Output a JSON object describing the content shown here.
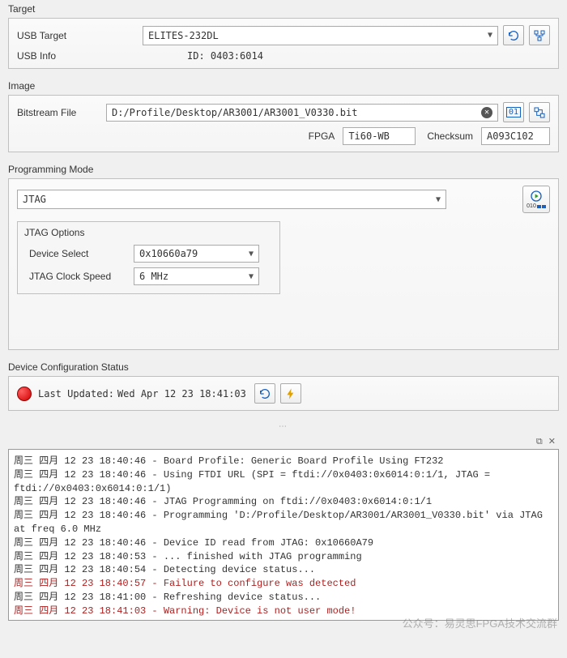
{
  "target": {
    "section_title": "Target",
    "usb_target_label": "USB Target",
    "usb_target_value": "ELITES-232DL",
    "usb_info_label": "USB Info",
    "usb_info_value": "ID: 0403:6014"
  },
  "image": {
    "section_title": "Image",
    "bitstream_label": "Bitstream File",
    "bitstream_value": "D:/Profile/Desktop/AR3001/AR3001_V0330.bit",
    "fpga_label": "FPGA",
    "fpga_value": "Ti60-WB",
    "checksum_label": "Checksum",
    "checksum_value": "A093C102"
  },
  "prog": {
    "section_title": "Programming Mode",
    "mode_value": "JTAG",
    "options_title": "JTAG Options",
    "device_select_label": "Device Select",
    "device_select_value": "0x10660a79",
    "clock_label": "JTAG Clock Speed",
    "clock_value": "6 MHz",
    "progress_label": "010"
  },
  "status": {
    "section_title": "Device Configuration Status",
    "last_updated_label": "Last Updated:",
    "last_updated_value": "Wed Apr 12 23 18:41:03"
  },
  "console": {
    "lines": [
      {
        "t": "周三 四月 12 23 18:40:46 - Board Profile: Generic Board Profile Using FT232",
        "err": false
      },
      {
        "t": "周三 四月 12 23 18:40:46 - Using FTDI URL (SPI = ftdi://0x0403:0x6014:0:1/1, JTAG = ftdi://0x0403:0x6014:0:1/1)",
        "err": false
      },
      {
        "t": "周三 四月 12 23 18:40:46 - JTAG Programming on ftdi://0x0403:0x6014:0:1/1",
        "err": false
      },
      {
        "t": "周三 四月 12 23 18:40:46 - Programming 'D:/Profile/Desktop/AR3001/AR3001_V0330.bit' via JTAG at freq 6.0 MHz",
        "err": false
      },
      {
        "t": "周三 四月 12 23 18:40:46 - Device ID read from JTAG: 0x10660A79",
        "err": false
      },
      {
        "t": "周三 四月 12 23 18:40:53 - ... finished with JTAG programming",
        "err": false
      },
      {
        "t": "周三 四月 12 23 18:40:54 - Detecting device status...",
        "err": false
      },
      {
        "t": "周三 四月 12 23 18:40:57 - Failure to configure was detected",
        "err": true
      },
      {
        "t": "周三 四月 12 23 18:41:00 - Refreshing device status...",
        "err": false
      },
      {
        "t": "周三 四月 12 23 18:41:03 - Warning: Device is not user mode!",
        "err": true
      }
    ]
  },
  "watermark": "公众号：易灵思FPGA技术交流群"
}
